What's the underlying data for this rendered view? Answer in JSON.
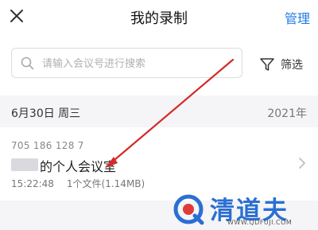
{
  "header": {
    "close_icon": "close-icon",
    "title": "我的录制",
    "manage_label": "管理",
    "accent_color": "#1f7be6"
  },
  "search": {
    "placeholder": "请输入会议号进行搜索",
    "icon": "search-icon"
  },
  "filter": {
    "label": "筛选",
    "icon": "filter-icon"
  },
  "section": {
    "date": "6月30日 周三",
    "year": "2021年"
  },
  "recording": {
    "meeting_id": "705 186 128 7",
    "title": "的个人会议室",
    "time": "15:22:48",
    "files": "1个文件(1.14MB)",
    "chevron_icon": "chevron-right-icon"
  },
  "annotation": {
    "arrow_color": "#d42a2a"
  },
  "watermark": {
    "text": "清道夫",
    "url": "WWW.QDFUJI.COM",
    "color": "#2a6fd3"
  }
}
